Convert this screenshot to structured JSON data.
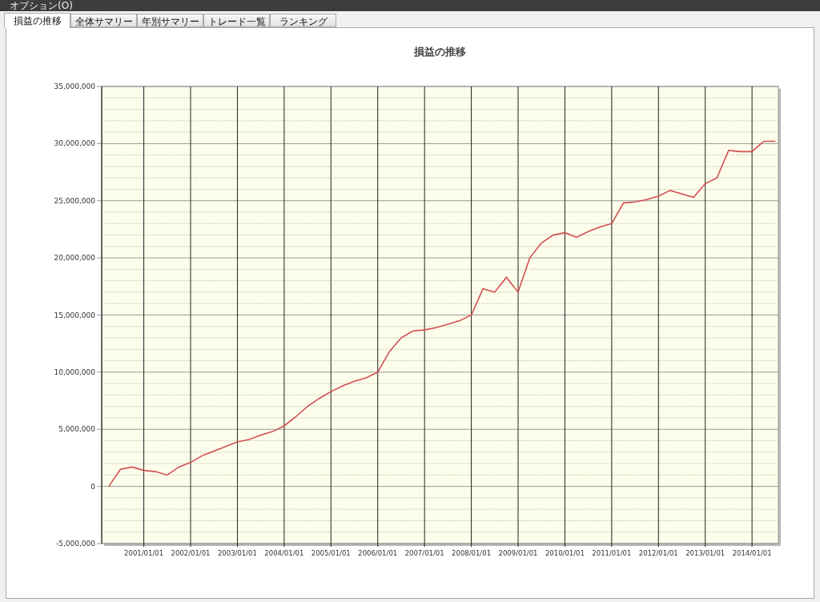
{
  "menu_bar": {
    "title": "オプション(O)"
  },
  "tabs": [
    {
      "label": "損益の推移",
      "selected": true
    },
    {
      "label": "全体サマリー",
      "selected": false
    },
    {
      "label": "年別サマリー",
      "selected": false
    },
    {
      "label": "トレード一覧",
      "selected": false
    },
    {
      "label": "ランキング",
      "selected": false
    }
  ],
  "chart": {
    "chart_data": {
      "type": "line",
      "title": "損益の推移",
      "categories": [
        null,
        null,
        null,
        "2001/01/01",
        null,
        null,
        null,
        "2002/01/01",
        null,
        null,
        null,
        "2003/01/01",
        null,
        null,
        null,
        "2004/01/01",
        null,
        null,
        null,
        "2005/01/01",
        null,
        null,
        null,
        "2006/01/01",
        null,
        null,
        null,
        "2007/01/01",
        null,
        null,
        null,
        "2008/01/01",
        null,
        null,
        null,
        "2009/01/01",
        null,
        null,
        null,
        "2010/01/01",
        null,
        null,
        null,
        "2011/01/01",
        null,
        null,
        null,
        "2012/01/01",
        null,
        null,
        null,
        "2013/01/01",
        null,
        null,
        null,
        "2014/01/01",
        null,
        null
      ],
      "series": [
        {
          "color": "#d05050",
          "values": [
            0,
            1500000,
            1700000,
            1400000,
            1300000,
            1000000,
            1700000,
            2100000,
            2700000,
            3100000,
            3500000,
            3900000,
            4100000,
            4500000,
            4800000,
            5300000,
            6100000,
            7000000,
            7700000,
            8300000,
            8800000,
            9200000,
            9500000,
            10000000,
            11800000,
            13000000,
            13600000,
            13700000,
            13900000,
            14200000,
            14500000,
            15000000,
            17300000,
            17000000,
            18300000,
            17000000,
            20000000,
            21300000,
            22000000,
            22200000,
            21800000,
            22300000,
            22700000,
            23000000,
            24800000,
            24900000,
            25100000,
            25400000,
            25900000,
            25600000,
            25300000,
            26500000,
            27000000,
            29400000,
            29300000,
            29300000,
            30200000,
            30200000
          ]
        }
      ],
      "grid": true,
      "ylim": [
        -5000000,
        35000000
      ],
      "yticks": [
        {
          "value": -5000000,
          "label": "-5,000,000"
        },
        {
          "value": 0,
          "label": "0"
        },
        {
          "value": 5000000,
          "label": "5,000,000"
        },
        {
          "value": 10000000,
          "label": "10,000,000"
        },
        {
          "value": 15000000,
          "label": "15,000,000"
        },
        {
          "value": 20000000,
          "label": "20,000,000"
        },
        {
          "value": 25000000,
          "label": "25,000,000"
        },
        {
          "value": 30000000,
          "label": "30,000,000"
        },
        {
          "value": 35000000,
          "label": "35,000,000"
        }
      ]
    }
  }
}
